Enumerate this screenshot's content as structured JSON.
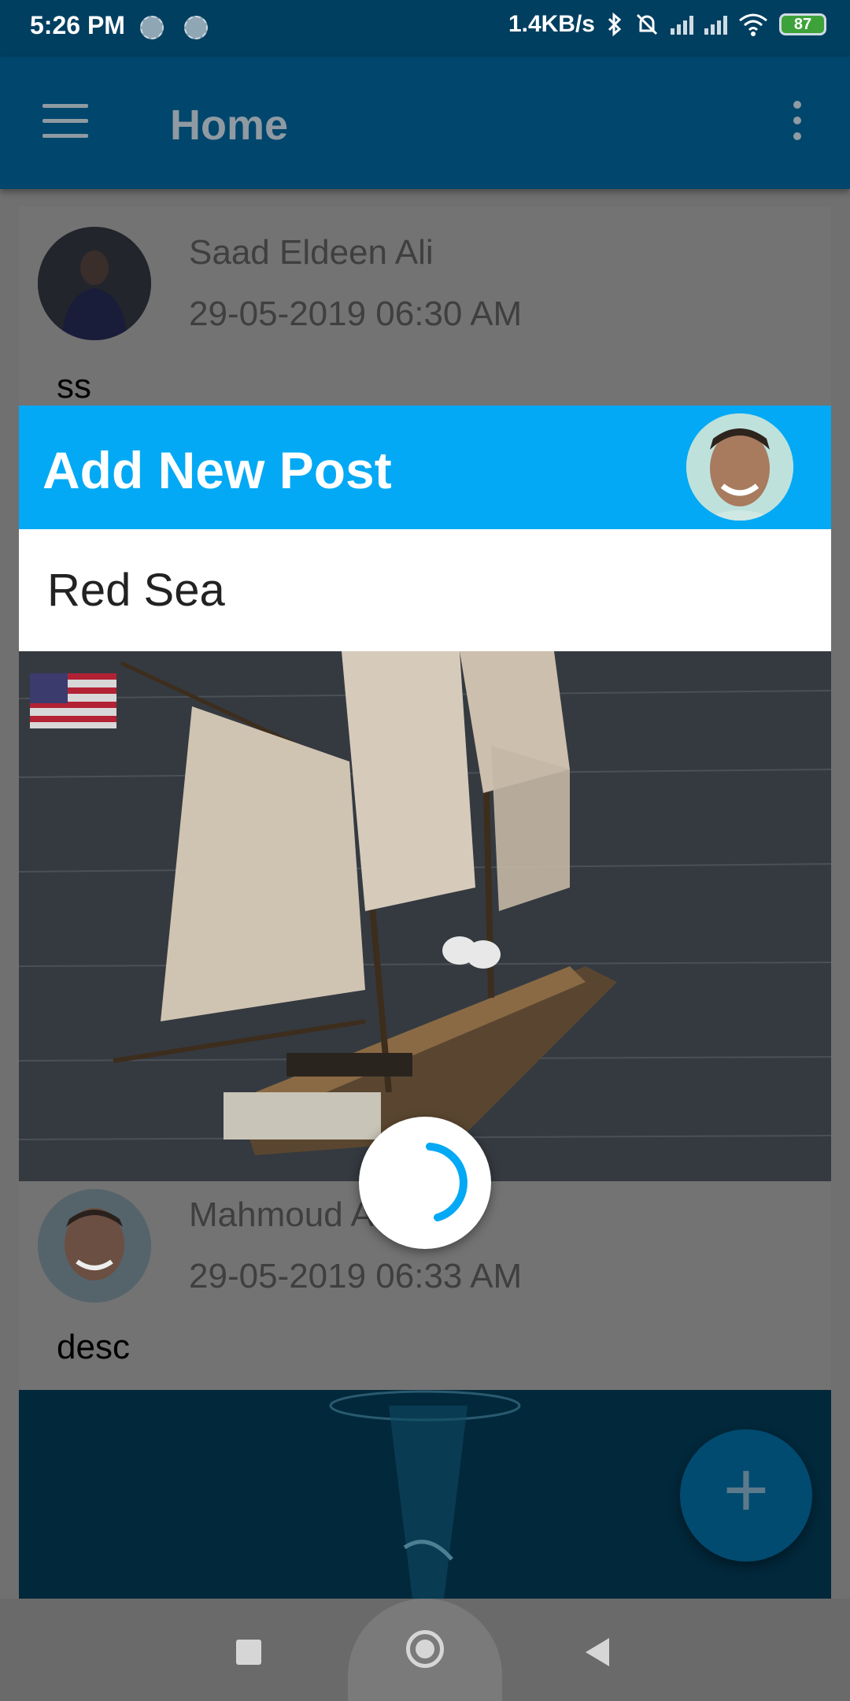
{
  "status_bar": {
    "time": "5:26 PM",
    "network_speed": "1.4KB/s",
    "battery": "87"
  },
  "app_bar": {
    "title": "Home"
  },
  "feed": {
    "posts": [
      {
        "author": "Saad Eldeen Ali",
        "date": "29-05-2019 06:30 AM",
        "text": "ss"
      },
      {
        "author": "Mahmoud A",
        "date": "29-05-2019 06:33 AM",
        "text": "desc"
      }
    ]
  },
  "dialog": {
    "title": "Add New Post",
    "input_value": "Red Sea"
  },
  "fab": {
    "icon": "plus-icon",
    "label": "+"
  },
  "colors": {
    "app_bar": "#01466c",
    "dialog_header": "#03a9f4",
    "spinner": "#03a9f4",
    "fab": "#014b70"
  }
}
